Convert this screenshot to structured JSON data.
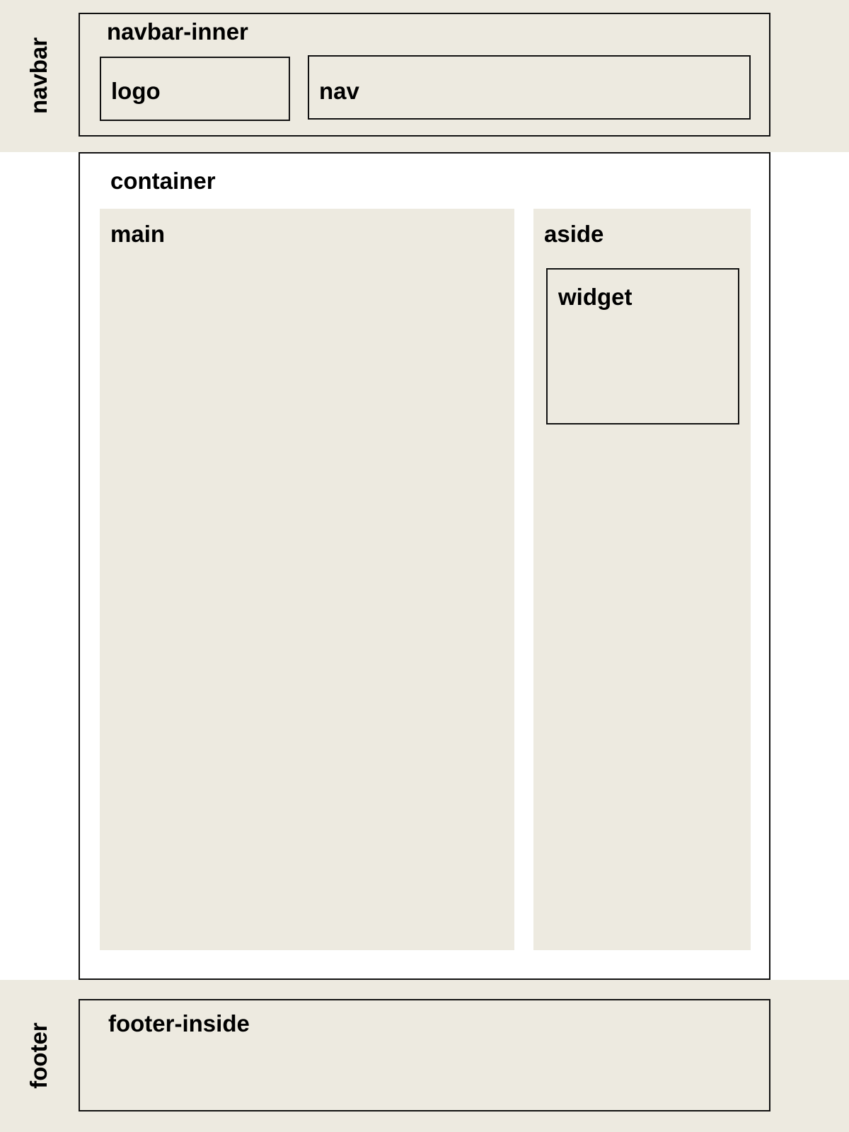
{
  "navbar": {
    "label": "navbar",
    "inner_label": "navbar-inner",
    "logo_label": "logo",
    "nav_label": "nav"
  },
  "container": {
    "label": "container",
    "main_label": "main",
    "aside_label": "aside",
    "widget_label": "widget"
  },
  "footer": {
    "label": "footer",
    "inside_label": "footer-inside"
  },
  "colors": {
    "region_fill": "#edeae0",
    "border": "#111111"
  }
}
